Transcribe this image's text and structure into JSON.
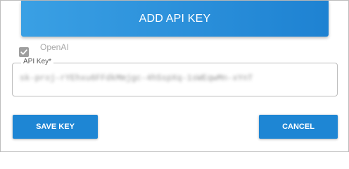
{
  "header": {
    "add_key_label": "ADD API KEY"
  },
  "provider": {
    "label": "OpenAI",
    "checked": true
  },
  "api_key_field": {
    "label": "API Key*",
    "value": "sk-proj-rYEhxu6FFdkMmjgc-4hSspXq-1sWEqwMn-xYnT"
  },
  "actions": {
    "save_label": "SAVE KEY",
    "cancel_label": "CANCEL"
  },
  "colors": {
    "primary": "#1e86d4",
    "primary_light": "#3aa0e4",
    "border": "#bdbdbd",
    "disabled_text": "#a8a8a8"
  }
}
